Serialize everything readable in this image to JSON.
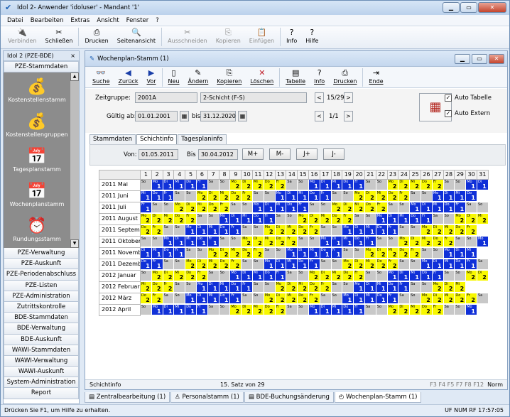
{
  "app": {
    "title": "Idol 2- Anwender 'idoluser' - Mandant '1'",
    "minimize": "▁",
    "maximize": "▭",
    "close": "✕"
  },
  "menu": [
    "Datei",
    "Bearbeiten",
    "Extras",
    "Ansicht",
    "Fenster",
    "?"
  ],
  "toolbar": {
    "items": [
      {
        "label": "Verbinden",
        "icon": "plug-icon",
        "glyph": "🔌",
        "disabled": true
      },
      {
        "label": "Schließen",
        "icon": "disconnect-icon",
        "glyph": "✂",
        "disabled": false
      },
      {
        "label": "Drucken",
        "icon": "printer-icon",
        "glyph": "⎙",
        "disabled": false
      },
      {
        "label": "Seitenansicht",
        "icon": "preview-icon",
        "glyph": "🔍",
        "disabled": false
      },
      {
        "label": "Ausschneiden",
        "icon": "cut-icon",
        "glyph": "✂",
        "disabled": true
      },
      {
        "label": "Kopieren",
        "icon": "copy-icon",
        "glyph": "⎘",
        "disabled": true
      },
      {
        "label": "Einfügen",
        "icon": "paste-icon",
        "glyph": "📋",
        "disabled": true
      },
      {
        "label": "Info",
        "icon": "info-icon",
        "glyph": "?",
        "disabled": false
      },
      {
        "label": "Hilfe",
        "icon": "help-icon",
        "glyph": "?",
        "disabled": false
      }
    ]
  },
  "left": {
    "header": "Idol 2 (PZE-BDE)",
    "header_close": "×",
    "top_section": "PZE-Stammdaten",
    "gray_items": [
      {
        "label": "Kostenstellenstamm",
        "icon": "cash-register-icon",
        "glyph": "💰"
      },
      {
        "label": "Kostenstellengruppen",
        "icon": "cash-register-group-icon",
        "glyph": "💰"
      },
      {
        "label": "Tagesplanstamm",
        "icon": "calendar-icon",
        "glyph": "📅"
      },
      {
        "label": "Wochenplanstamm",
        "icon": "week-calendar-icon",
        "glyph": "📅"
      },
      {
        "label": "Rundungsstamm",
        "icon": "clock-icon",
        "glyph": "⏰"
      }
    ],
    "sections": [
      "PZE-Verwaltung",
      "PZE-Auskunft",
      "PZE-Periodenabschluss",
      "PZE-Listen",
      "PZE-Administration",
      "Zutrittskontrolle",
      "BDE-Stammdaten",
      "BDE-Verwaltung",
      "BDE-Auskunft",
      "WAWI-Stammdaten",
      "WAWI-Verwaltung",
      "WAWI-Auskunft",
      "System-Administration",
      "Report"
    ]
  },
  "window": {
    "title": "Wochenplan-Stamm (1)",
    "tools": [
      {
        "label": "Suche",
        "icon": "binoculars-icon",
        "glyph": "👓"
      },
      {
        "label": "Zurück",
        "icon": "arrow-left-icon",
        "glyph": "◀"
      },
      {
        "label": "Vor",
        "icon": "arrow-right-icon",
        "glyph": "▶"
      },
      {
        "label": "Neu",
        "icon": "new-icon",
        "glyph": "▯"
      },
      {
        "label": "Ändern",
        "icon": "edit-icon",
        "glyph": "✎"
      },
      {
        "label": "Kopieren",
        "icon": "copy-icon",
        "glyph": "⎘"
      },
      {
        "label": "Löschen",
        "icon": "delete-icon",
        "glyph": "✕"
      },
      {
        "label": "Tabelle",
        "icon": "table-icon",
        "glyph": "▤"
      },
      {
        "label": "Info",
        "icon": "info-icon",
        "glyph": "?"
      },
      {
        "label": "Drucken",
        "icon": "printer-icon",
        "glyph": "⎙"
      },
      {
        "label": "Ende",
        "icon": "exit-icon",
        "glyph": "⇥"
      }
    ],
    "zeitgruppe_label": "Zeitgruppe:",
    "zeitgruppe_value": "2001A",
    "zeitgruppe_desc": "2-Schicht (F-S)",
    "gueltig_label": "Gültig ab:",
    "gueltig_value": "01.01.2001",
    "bis_label": "bis:",
    "bis_value": "31.12.2020",
    "nav1": "15/29",
    "nav2": "1/1",
    "auto_tabelle": "Auto Tabelle",
    "auto_extern": "Auto Extern",
    "tabs": [
      "Stammdaten",
      "Schichtinfo",
      "Tagesplaninfo"
    ],
    "active_tab": "Schichtinfo",
    "von_label": "Von:",
    "von_value": "01.05.2011",
    "bis2_label": "Bis",
    "bis2_value": "30.04.2012",
    "range_buttons": [
      "M+",
      "M-",
      "J+",
      "J-"
    ],
    "status_left": "Schichtinfo",
    "status_mid": "15. Satz von 29",
    "status_keys": "F3  F4  F5  F7  F8  F12",
    "status_mode": "Norm"
  },
  "calendar": {
    "day_numbers": [
      1,
      2,
      3,
      4,
      5,
      6,
      7,
      8,
      9,
      10,
      11,
      12,
      13,
      14,
      15,
      16,
      17,
      18,
      19,
      20,
      21,
      22,
      23,
      24,
      25,
      26,
      27,
      28,
      29,
      30,
      31
    ],
    "weekday_abbr": {
      "Mo": "Mo",
      "Di": "Di",
      "Mi": "Mi",
      "Do": "Do",
      "Fr": "Fr",
      "Sa": "Sa",
      "So": "So"
    },
    "colors": {
      "blue": "#1030d8",
      "yellow": "#f8f800",
      "gray": "#c8c8c8"
    },
    "months": [
      {
        "label": "2011 Mai",
        "start": 6,
        "days": 31,
        "ym": "2011-05"
      },
      {
        "label": "2011 Juni",
        "start": 2,
        "days": 30,
        "ym": "2011-06"
      },
      {
        "label": "2011 Juli",
        "start": 4,
        "days": 31,
        "ym": "2011-07"
      },
      {
        "label": "2011 August",
        "start": 0,
        "days": 31,
        "ym": "2011-08"
      },
      {
        "label": "2011 Septem",
        "start": 3,
        "days": 30,
        "ym": "2011-09"
      },
      {
        "label": "2011 Oktober",
        "start": 5,
        "days": 31,
        "ym": "2011-10"
      },
      {
        "label": "2011 Novemb",
        "start": 1,
        "days": 30,
        "ym": "2011-11"
      },
      {
        "label": "2011 Dezemb",
        "start": 3,
        "days": 31,
        "ym": "2011-12"
      },
      {
        "label": "2012 Januar",
        "start": 6,
        "days": 31,
        "ym": "2012-01"
      },
      {
        "label": "2012 Februar",
        "start": 2,
        "days": 29,
        "ym": "2012-02"
      },
      {
        "label": "2012 März",
        "start": 3,
        "days": 31,
        "ym": "2012-03"
      },
      {
        "label": "2012 April",
        "start": 6,
        "days": 30,
        "ym": "2012-04"
      }
    ]
  },
  "bottom_tabs": [
    {
      "label": "Zentralbearbeitung (1)",
      "icon": "form-icon"
    },
    {
      "label": "Personalstamm (1)",
      "icon": "person-icon"
    },
    {
      "label": "BDE-Buchungsänderung",
      "icon": "form-icon"
    },
    {
      "label": "Wochenplan-Stamm (1)",
      "icon": "calendar-icon",
      "active": true
    }
  ],
  "statusbar": {
    "hint": "Drücken Sie F1, um Hilfe zu erhalten.",
    "right": "UF  NUM  RF  17:57:05"
  }
}
